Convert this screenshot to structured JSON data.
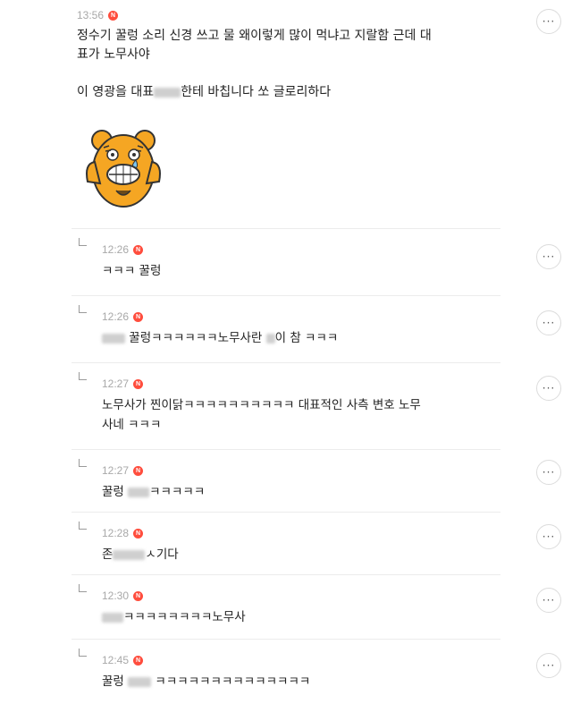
{
  "main": {
    "time": "13:56",
    "badge": "N",
    "line1a": "정수기 꿀렁 소리 신경 쓰고 물 왜이렇게 많이 먹냐고 지랄함 근데 대",
    "line1b": "표가 노무사야",
    "line2a": "이 영광을 대표",
    "line2b": "한테 바칩니다 쏘 글로리하다",
    "more": "···"
  },
  "replies": [
    {
      "time": "12:26",
      "badge": "N",
      "pre": "",
      "text": "ㅋㅋㅋ 꿀렁",
      "more": "···"
    },
    {
      "time": "12:26",
      "badge": "N",
      "pre": "",
      "text": " 꿀렁ㅋㅋㅋㅋㅋㅋ노무사란 ",
      "post": "이 참 ㅋㅋㅋ",
      "more": "···"
    },
    {
      "time": "12:27",
      "badge": "N",
      "pre": "",
      "text": "노무사가 찐이닭ㅋㅋㅋㅋㅋㅋㅋㅋㅋㅋ 대표적인 사측 변호 노무",
      "text2": "사네 ㅋㅋㅋ",
      "more": "···"
    },
    {
      "time": "12:27",
      "badge": "N",
      "pre": "꿀렁 ",
      "text": "ㅋㅋㅋㅋㅋ",
      "more": "···"
    },
    {
      "time": "12:28",
      "badge": "N",
      "pre": "존",
      "text": "ㅅ기다",
      "more": "···"
    },
    {
      "time": "12:30",
      "badge": "N",
      "pre": "",
      "text": "ㅋㅋㅋㅋㅋㅋㅋㅋ노무사",
      "more": "···"
    },
    {
      "time": "12:45",
      "badge": "N",
      "pre": "꿀렁 ",
      "text": " ㅋㅋㅋㅋㅋㅋㅋㅋㅋㅋㅋㅋㅋㅋ",
      "more": "···"
    }
  ]
}
